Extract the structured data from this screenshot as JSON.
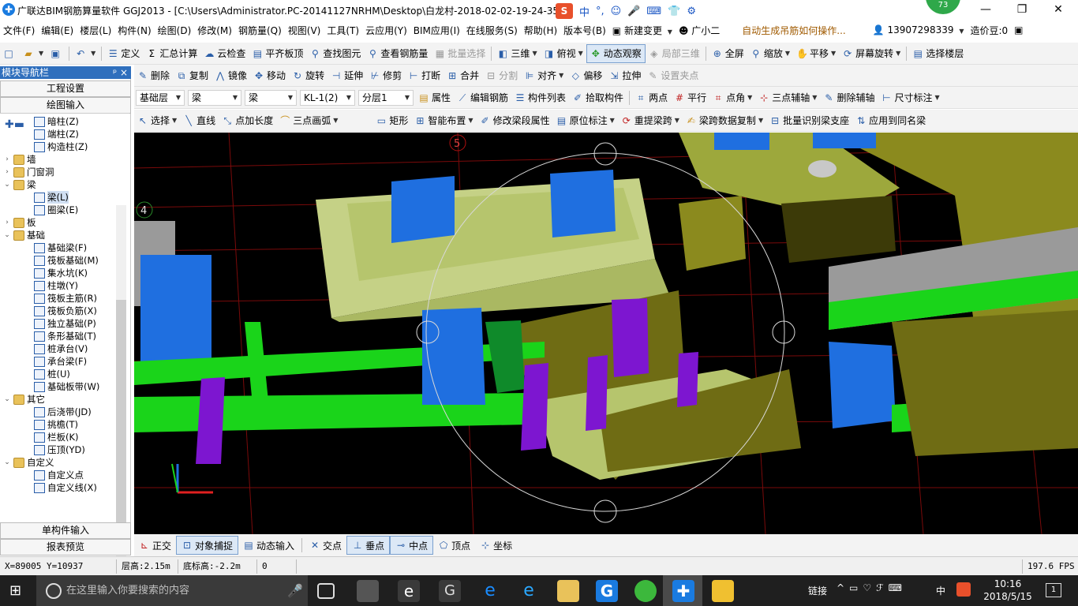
{
  "titlebar": {
    "title": "广联达BIM钢筋算量软件 GGJ2013 - [C:\\Users\\Administrator.PC-20141127NRHM\\Desktop\\白龙村-2018-02-02-19-24-35",
    "badge": "73",
    "ime": [
      "中",
      "°,",
      "☺",
      "🎤",
      "⌨",
      "👕",
      "⚙"
    ]
  },
  "menu": [
    "文件(F)",
    "编辑(E)",
    "楼层(L)",
    "构件(N)",
    "绘图(D)",
    "修改(M)",
    "钢筋量(Q)",
    "视图(V)",
    "工具(T)",
    "云应用(Y)",
    "BIM应用(I)",
    "在线服务(S)",
    "帮助(H)",
    "版本号(B)",
    "新建变更",
    "广小二",
    "自动生成吊筋如何操作...",
    "13907298339",
    "造价豆:0"
  ],
  "toolbar1": [
    "定义",
    "汇总计算",
    "云检查",
    "平齐板顶",
    "查找图元",
    "查看钢筋量",
    "批量选择",
    "三维",
    "俯视",
    "动态观察",
    "局部三维",
    "全屏",
    "缩放",
    "平移",
    "屏幕旋转",
    "选择楼层"
  ],
  "toolbar2": [
    "删除",
    "复制",
    "镜像",
    "移动",
    "旋转",
    "延伸",
    "修剪",
    "打断",
    "合并",
    "分割",
    "对齐",
    "偏移",
    "拉伸",
    "设置夹点"
  ],
  "toolbar3": {
    "floor": "基础层",
    "cat": "梁",
    "type": "梁",
    "comp": "KL-1(2)",
    "layer": "分层1",
    "buttons": [
      "属性",
      "编辑钢筋",
      "构件列表",
      "拾取构件",
      "两点",
      "平行",
      "点角",
      "三点辅轴",
      "删除辅轴",
      "尺寸标注"
    ]
  },
  "toolbar4": [
    "选择",
    "直线",
    "点加长度",
    "三点画弧",
    "矩形",
    "智能布置",
    "修改梁段属性",
    "原位标注",
    "重提梁跨",
    "梁跨数据复制",
    "批量识别梁支座",
    "应用到同名梁"
  ],
  "sidebar": {
    "title": "模块导航栏",
    "pin": "ᵖ ×",
    "tab1": "工程设置",
    "tab2": "绘图输入",
    "tab3": "单构件输入",
    "tab4": "报表预览",
    "tree": [
      {
        "l": "暗柱(Z)",
        "d": 3,
        "f": false
      },
      {
        "l": "端柱(Z)",
        "d": 3,
        "f": false
      },
      {
        "l": "构造柱(Z)",
        "d": 3,
        "f": false
      },
      {
        "l": "墙",
        "d": 1,
        "f": true,
        "e": ">"
      },
      {
        "l": "门窗洞",
        "d": 1,
        "f": true,
        "e": ">"
      },
      {
        "l": "梁",
        "d": 1,
        "f": true,
        "e": "v"
      },
      {
        "l": "梁(L)",
        "d": 3,
        "f": false,
        "sel": true
      },
      {
        "l": "圈梁(E)",
        "d": 3,
        "f": false
      },
      {
        "l": "板",
        "d": 1,
        "f": true,
        "e": ">"
      },
      {
        "l": "基础",
        "d": 1,
        "f": true,
        "e": "v"
      },
      {
        "l": "基础梁(F)",
        "d": 3,
        "f": false
      },
      {
        "l": "筏板基础(M)",
        "d": 3,
        "f": false
      },
      {
        "l": "集水坑(K)",
        "d": 3,
        "f": false
      },
      {
        "l": "柱墩(Y)",
        "d": 3,
        "f": false
      },
      {
        "l": "筏板主筋(R)",
        "d": 3,
        "f": false
      },
      {
        "l": "筏板负筋(X)",
        "d": 3,
        "f": false
      },
      {
        "l": "独立基础(P)",
        "d": 3,
        "f": false
      },
      {
        "l": "条形基础(T)",
        "d": 3,
        "f": false
      },
      {
        "l": "桩承台(V)",
        "d": 3,
        "f": false
      },
      {
        "l": "承台梁(F)",
        "d": 3,
        "f": false
      },
      {
        "l": "桩(U)",
        "d": 3,
        "f": false
      },
      {
        "l": "基础板带(W)",
        "d": 3,
        "f": false
      },
      {
        "l": "其它",
        "d": 1,
        "f": true,
        "e": "v"
      },
      {
        "l": "后浇带(JD)",
        "d": 3,
        "f": false
      },
      {
        "l": "挑檐(T)",
        "d": 3,
        "f": false
      },
      {
        "l": "栏板(K)",
        "d": 3,
        "f": false
      },
      {
        "l": "压顶(YD)",
        "d": 3,
        "f": false
      },
      {
        "l": "自定义",
        "d": 1,
        "f": true,
        "e": "v"
      },
      {
        "l": "自定义点",
        "d": 3,
        "f": false
      },
      {
        "l": "自定义线(X)",
        "d": 3,
        "f": false
      }
    ]
  },
  "viewport": {
    "axis5": "5",
    "axis4": "4"
  },
  "bottombar": [
    "正交",
    "对象捕捉",
    "动态输入",
    "交点",
    "垂点",
    "中点",
    "顶点",
    "坐标"
  ],
  "status": {
    "coords": "X=89005 Y=10937",
    "floor_h": "层高:2.15m",
    "base_h": "底标高:-2.2m",
    "zero": "0",
    "fps": "197.6 FPS"
  },
  "taskbar": {
    "search": "在这里输入你要搜索的内容",
    "link": "链接",
    "lang": "中",
    "time": "10:16",
    "date": "2018/5/15",
    "notif": "1"
  }
}
